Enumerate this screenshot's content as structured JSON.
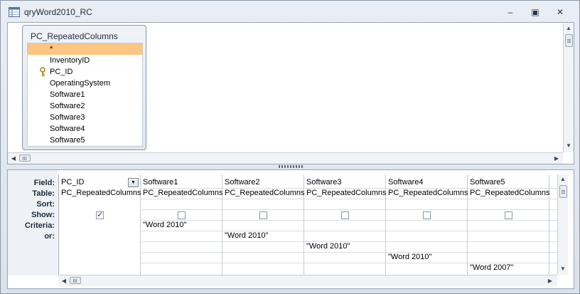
{
  "window": {
    "title": "qryWord2010_RC",
    "minimize_glyph": "–",
    "restore_glyph": "▣",
    "close_glyph": "✕"
  },
  "table_box": {
    "title": "PC_RepeatedColumns",
    "fields": [
      {
        "label": "*",
        "selected": true,
        "key": false
      },
      {
        "label": "InventoryID",
        "selected": false,
        "key": false
      },
      {
        "label": "PC_ID",
        "selected": false,
        "key": true
      },
      {
        "label": "OperatingSystem",
        "selected": false,
        "key": false
      },
      {
        "label": "Software1",
        "selected": false,
        "key": false
      },
      {
        "label": "Software2",
        "selected": false,
        "key": false
      },
      {
        "label": "Software3",
        "selected": false,
        "key": false
      },
      {
        "label": "Software4",
        "selected": false,
        "key": false
      },
      {
        "label": "Software5",
        "selected": false,
        "key": false
      }
    ]
  },
  "grid": {
    "row_labels": [
      "Field:",
      "Table:",
      "Sort:",
      "Show:",
      "Criteria:",
      "or:"
    ],
    "columns": [
      {
        "field": "PC_ID",
        "table": "PC_RepeatedColumns",
        "show": true,
        "criteria": [
          "",
          "",
          "",
          "",
          ""
        ]
      },
      {
        "field": "Software1",
        "table": "PC_RepeatedColumns",
        "show": false,
        "criteria": [
          "\"Word 2010\"",
          "",
          "",
          "",
          ""
        ]
      },
      {
        "field": "Software2",
        "table": "PC_RepeatedColumns",
        "show": false,
        "criteria": [
          "",
          "\"Word 2010\"",
          "",
          "",
          ""
        ]
      },
      {
        "field": "Software3",
        "table": "PC_RepeatedColumns",
        "show": false,
        "criteria": [
          "",
          "",
          "\"Word 2010\"",
          "",
          ""
        ]
      },
      {
        "field": "Software4",
        "table": "PC_RepeatedColumns",
        "show": false,
        "criteria": [
          "",
          "",
          "",
          "\"Word 2010\"",
          ""
        ]
      },
      {
        "field": "Software5",
        "table": "PC_RepeatedColumns",
        "show": false,
        "criteria": [
          "",
          "",
          "",
          "",
          "\"Word 2007\""
        ]
      }
    ]
  },
  "colors": {
    "selected_field": "#fbc582",
    "window_bg": "#dde3ea",
    "pane_border": "#9aa6b6"
  }
}
